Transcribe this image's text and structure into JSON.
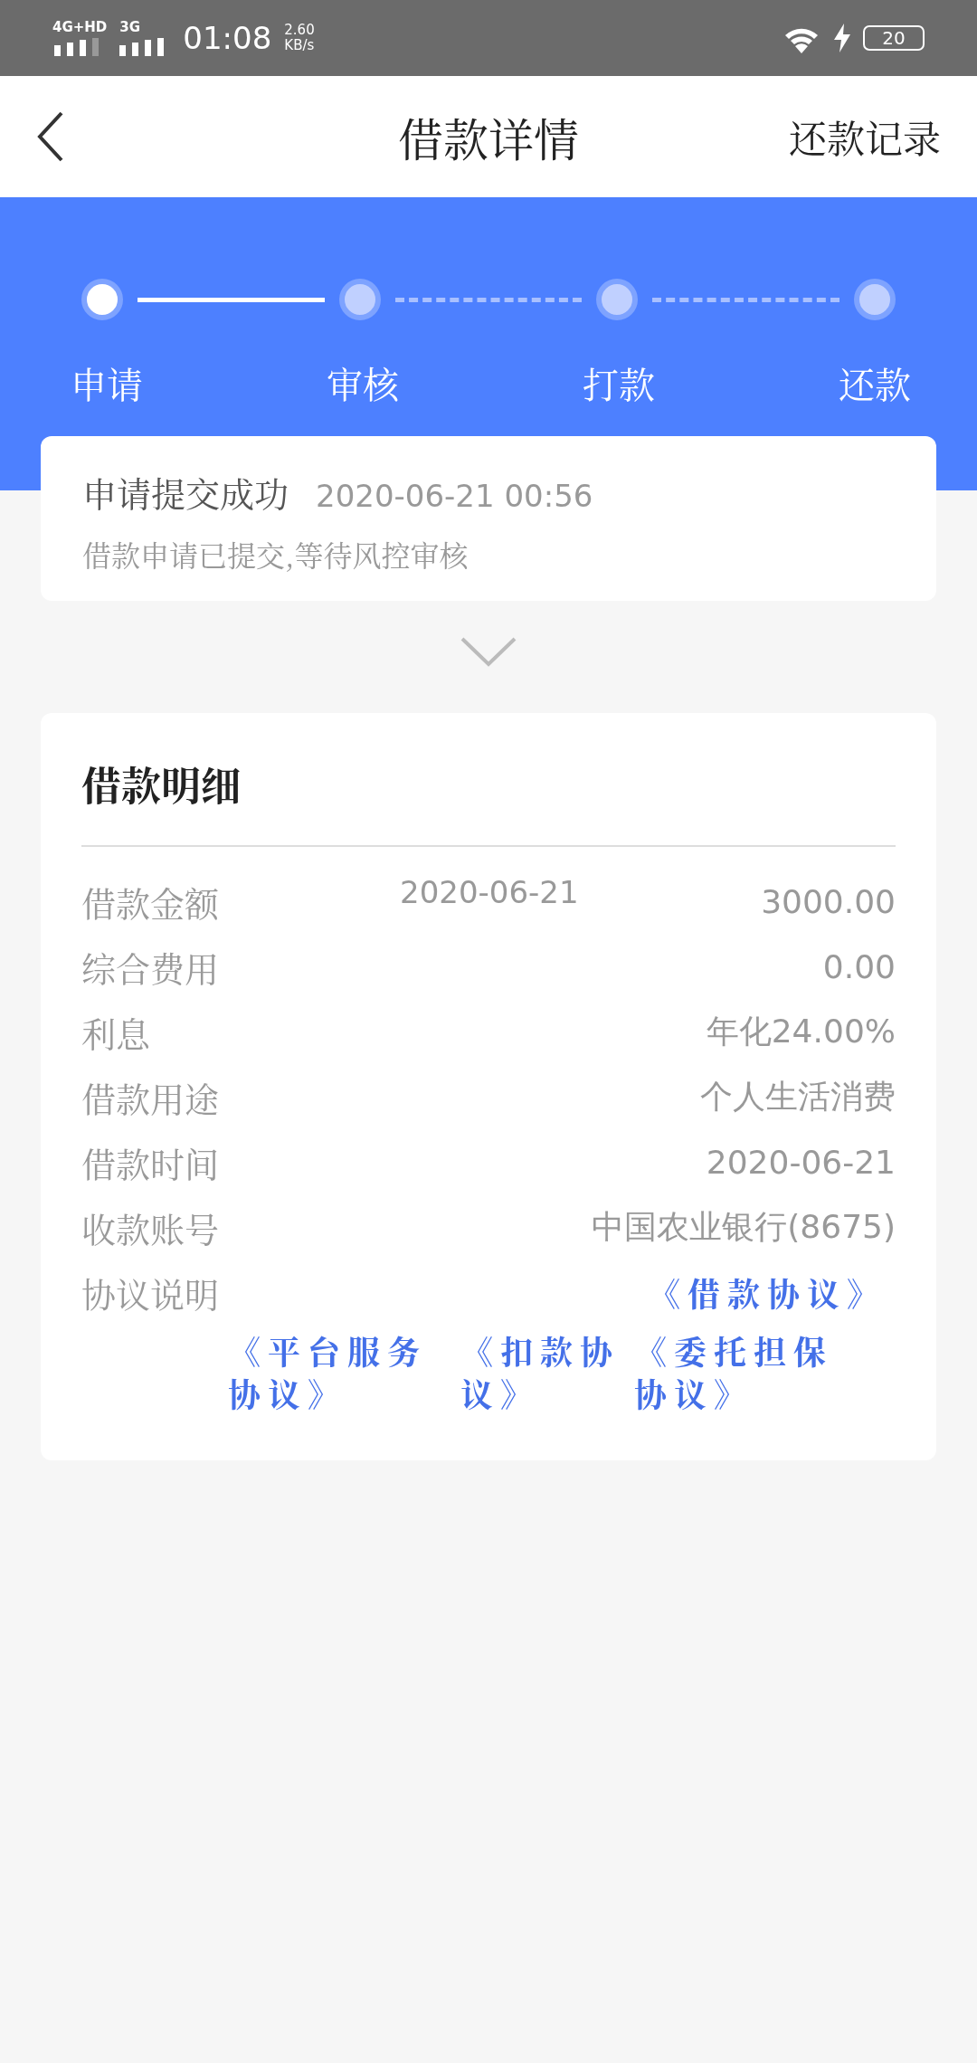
{
  "status_bar": {
    "network_1": "4G+HD",
    "network_2": "3G",
    "time": "01:08",
    "speed": "2.60",
    "speed_unit": "KB/s",
    "battery": "20"
  },
  "header": {
    "title": "借款详情",
    "action": "还款记录"
  },
  "steps": [
    {
      "label": "申请",
      "done": true
    },
    {
      "label": "审核",
      "done": false
    },
    {
      "label": "打款",
      "done": false
    },
    {
      "label": "还款",
      "done": false
    }
  ],
  "status_card": {
    "title": "申请提交成功",
    "time": "2020-06-21 00:56",
    "message": "借款申请已提交,等待风控审核"
  },
  "details": {
    "title": "借款明细",
    "rows": [
      {
        "label": "借款金额",
        "note": "2020-06-21",
        "value": "3000.00"
      },
      {
        "label": "综合费用",
        "value": "0.00"
      },
      {
        "label": "利息",
        "value": "年化24.00%"
      },
      {
        "label": "借款用途",
        "value": "个人生活消费"
      },
      {
        "label": "借款时间",
        "value": "2020-06-21"
      },
      {
        "label": "收款账号",
        "value": "中国农业银行(8675)"
      }
    ],
    "agreements_label": "协议说明",
    "agreements": [
      "《借款协议》",
      "《平台服务协议》",
      "《扣款协议》",
      "《委托担保协议》"
    ]
  }
}
